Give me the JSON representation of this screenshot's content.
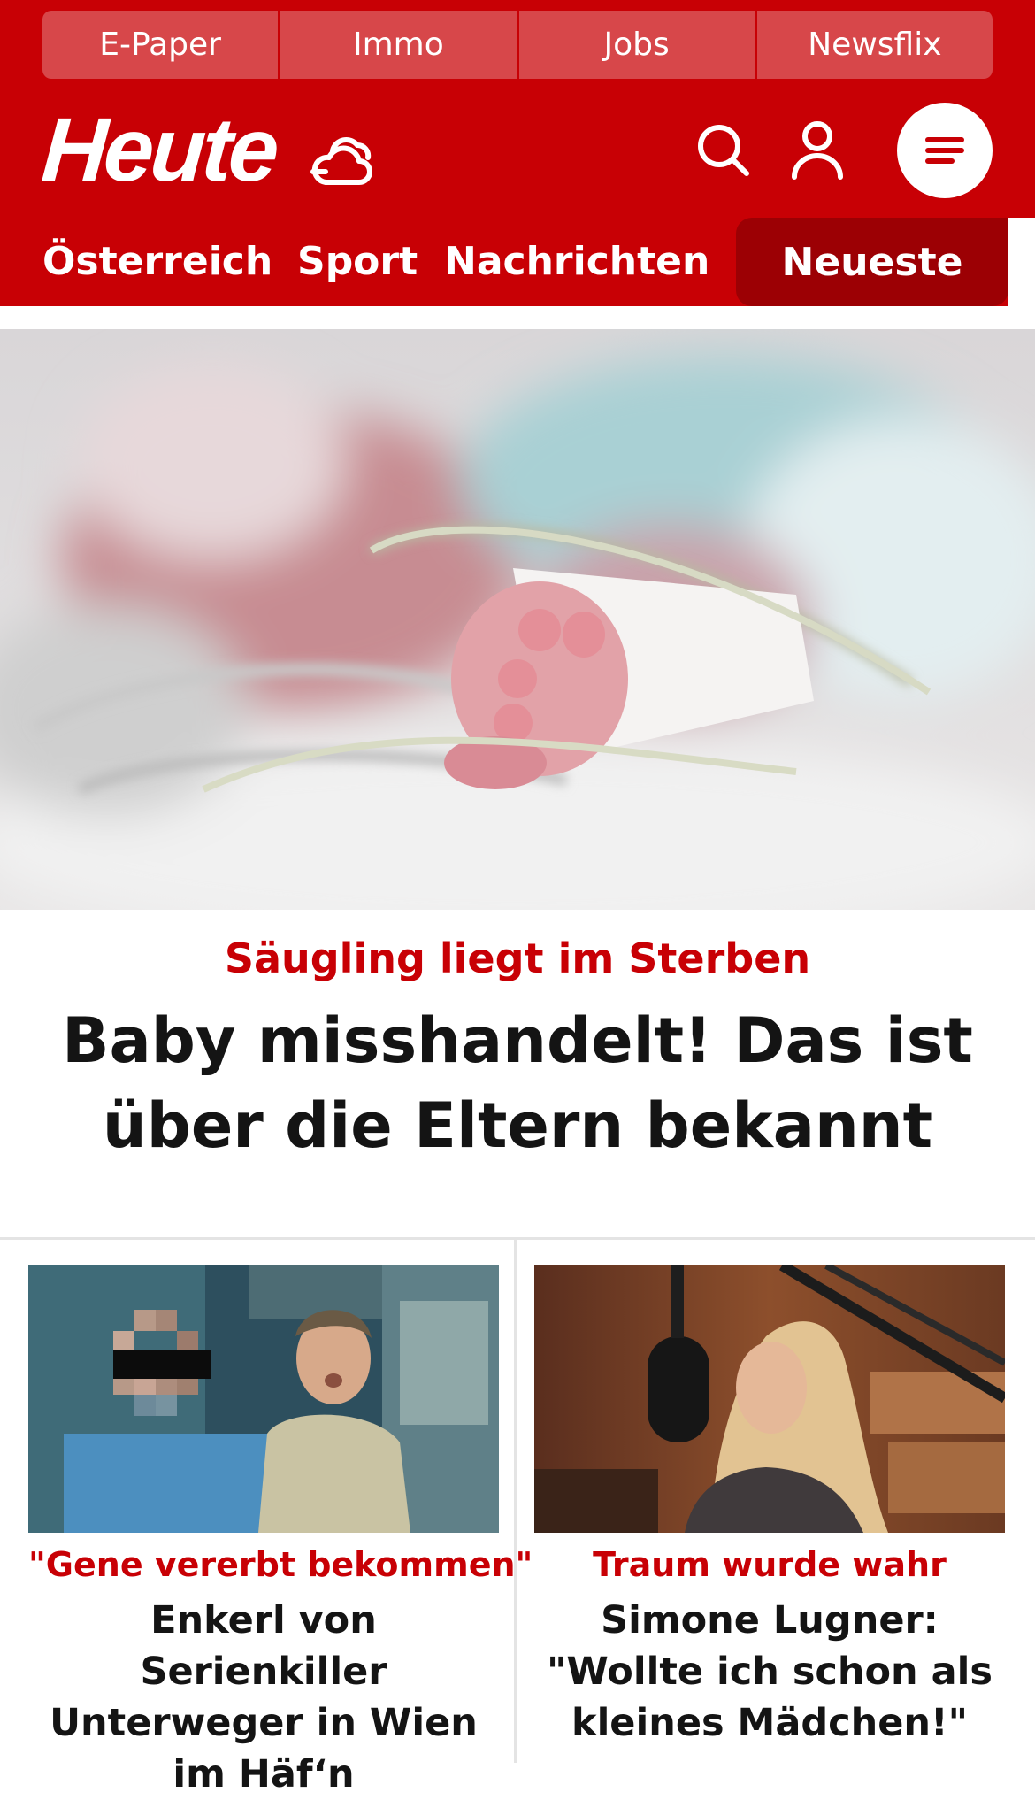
{
  "service_bar": {
    "tabs": [
      "E-Paper",
      "Immo",
      "Jobs",
      "Newsflix"
    ]
  },
  "header": {
    "logo_text": "Heute",
    "icons": [
      "weather-cloud-icon",
      "search-icon",
      "user-icon",
      "menu-icon"
    ]
  },
  "nav": {
    "items": [
      "Österreich",
      "Sport",
      "Nachrichten"
    ],
    "active_tab": "Neueste"
  },
  "hero": {
    "image_alt": "premature-baby-foot-with-sensor",
    "kicker": "Säugling liegt im Sterben",
    "title": "Baby misshandelt! Das ist über die Eltern bekannt"
  },
  "cards": [
    {
      "image_alt": "two-men-photo-one-pixelated",
      "kicker": "\"Gene vererbt bekommen\"",
      "title": "Enkerl von Serienkiller Unterweger in Wien im Häf‘n"
    },
    {
      "image_alt": "woman-at-radio-microphone",
      "kicker": "Traum wurde wahr",
      "title": "Simone Lugner: \"Wollte ich schon als kleines Mädchen!\""
    }
  ],
  "colors": {
    "brand_red": "#c80005",
    "active_tab_red": "#9c0004",
    "headline": "#141414"
  }
}
